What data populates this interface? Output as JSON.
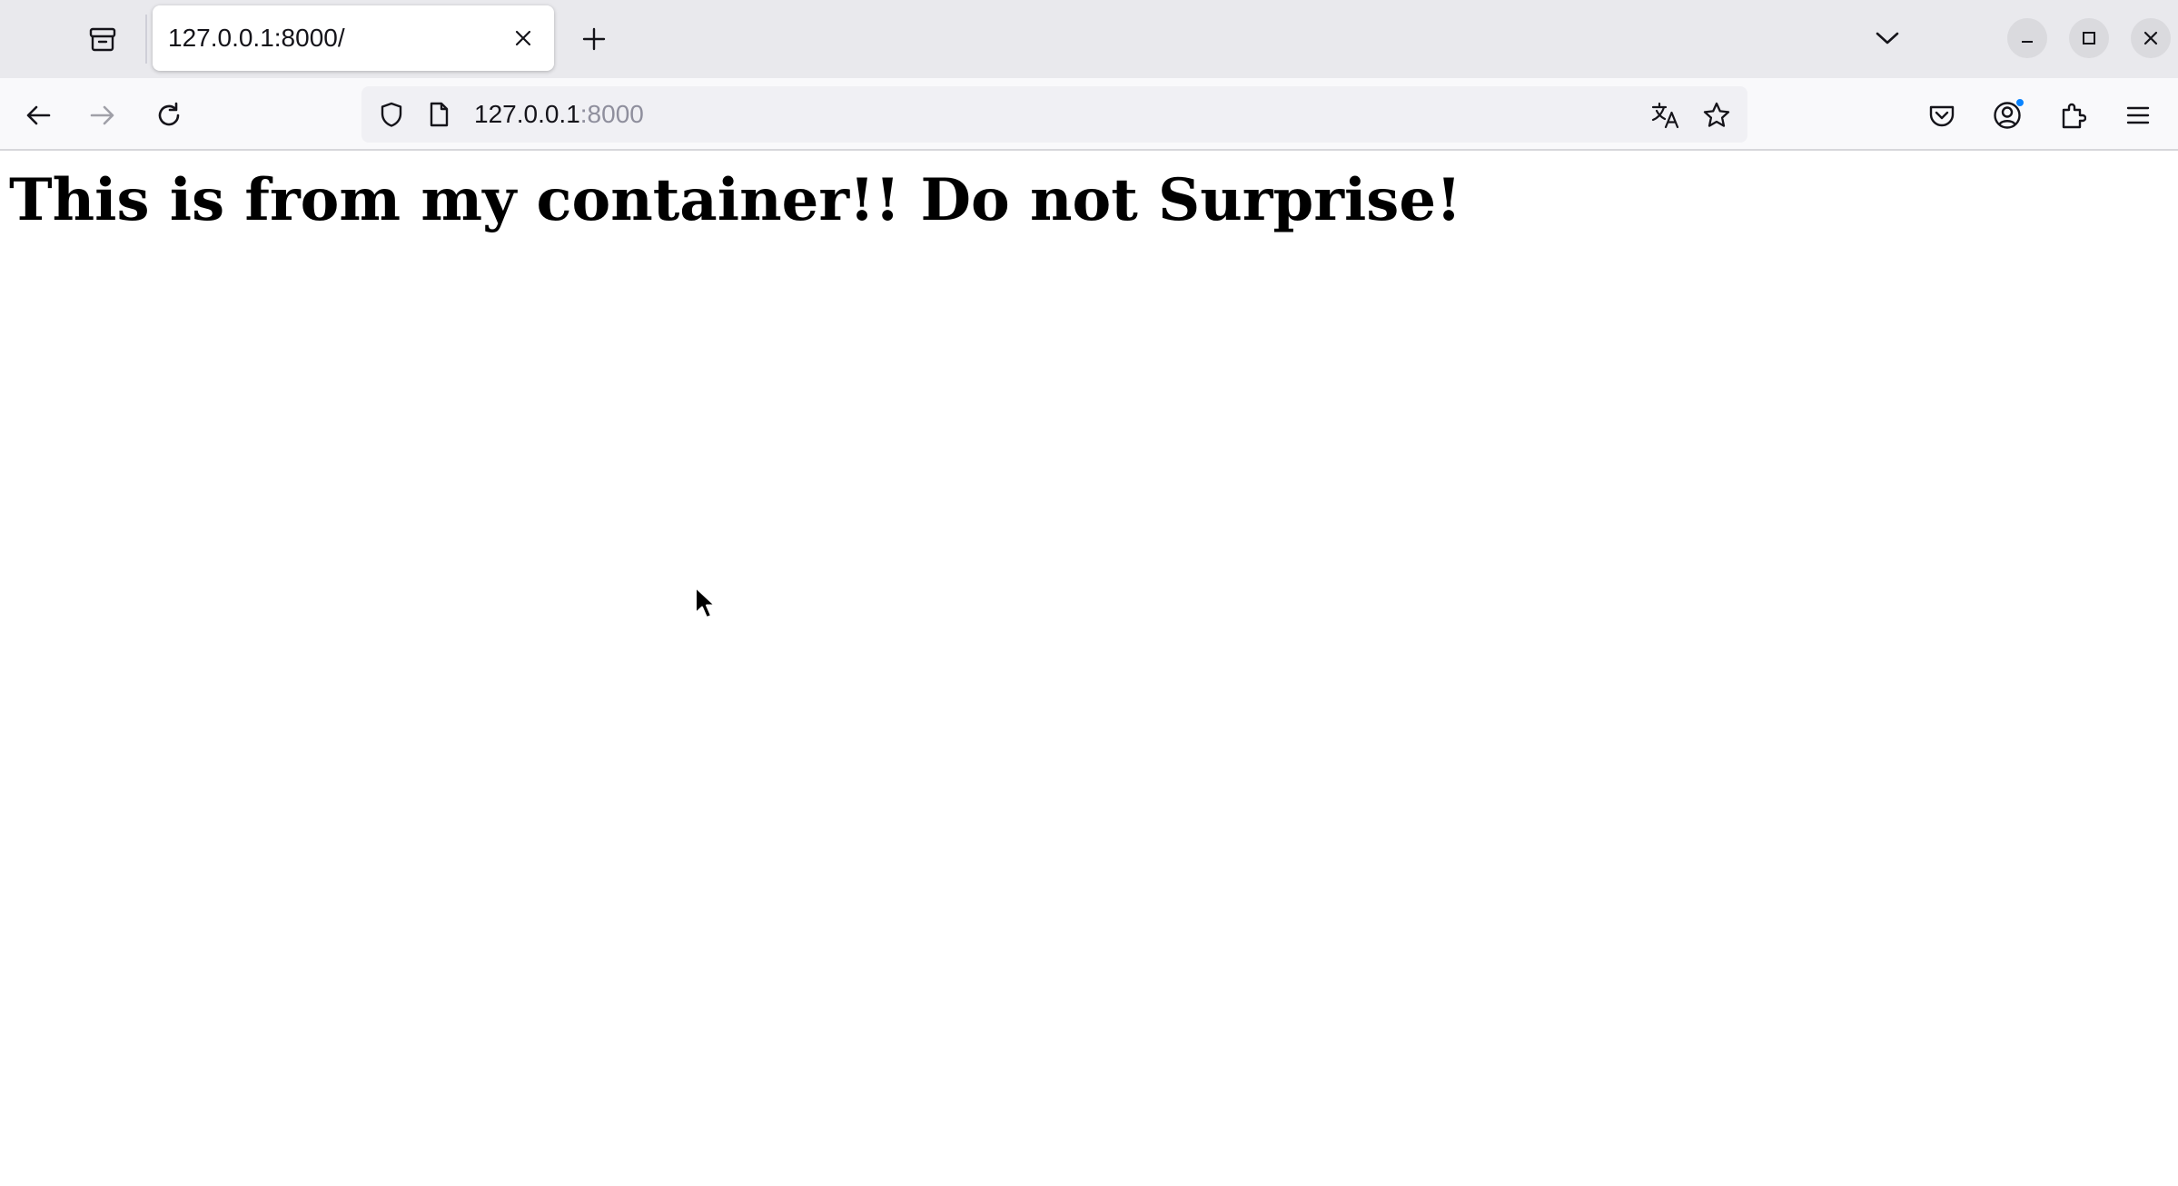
{
  "browser": {
    "tab": {
      "title": "127.0.0.1:8000/"
    },
    "urlbar": {
      "host": "127.0.0.1",
      "port": ":8000"
    },
    "icons": {
      "tab_manager": "tab-manager-icon",
      "close_tab": "close-icon",
      "new_tab": "plus-icon",
      "list_tabs": "chevron-down-icon",
      "minimize": "minimize-icon",
      "maximize": "maximize-icon",
      "close_window": "close-icon",
      "back": "arrow-left-icon",
      "forward": "arrow-right-icon",
      "reload": "reload-icon",
      "tracking_protection": "shield-icon",
      "page_info": "page-icon",
      "translate": "translate-icon",
      "bookmark": "star-icon",
      "pocket": "pocket-icon",
      "account": "account-icon",
      "extensions": "puzzle-icon",
      "app_menu": "hamburger-menu-icon"
    },
    "colors": {
      "tabstrip_bg": "#e9e9ed",
      "navbar_bg": "#f9f9fb",
      "urlbar_bg": "#f0f0f4",
      "account_badge": "#0a84ff"
    }
  },
  "page": {
    "heading": "This is from my container!! Do not Surprise!"
  }
}
